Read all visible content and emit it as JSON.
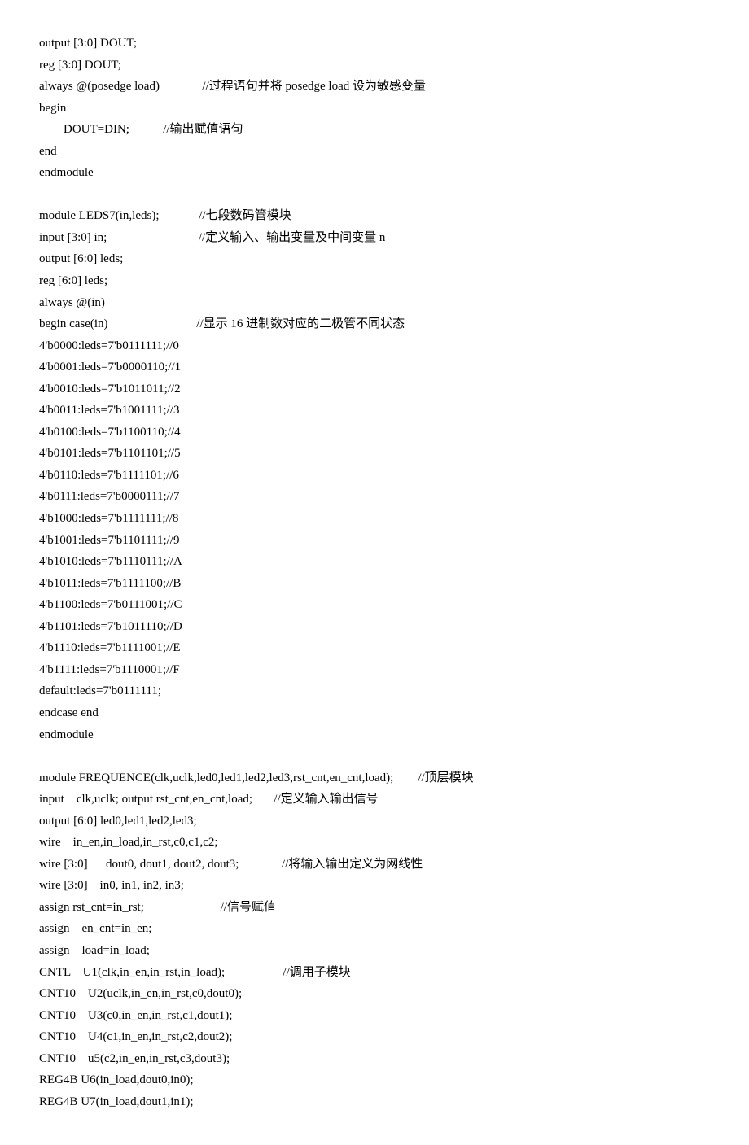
{
  "lines": [
    "output [3:0] DOUT;",
    "reg [3:0] DOUT;",
    "always @(posedge load)              //过程语句并将 posedge load 设为敏感变量",
    "begin",
    "        DOUT=DIN;           //输出赋值语句",
    "end",
    "endmodule",
    "",
    "module LEDS7(in,leds);             //七段数码管模块",
    "input [3:0] in;                              //定义输入、输出变量及中间变量 n",
    "output [6:0] leds;",
    "reg [6:0] leds;",
    "always @(in)",
    "begin case(in)                             //显示 16 进制数对应的二极管不同状态",
    "4'b0000:leds=7'b0111111;//0",
    "4'b0001:leds=7'b0000110;//1",
    "4'b0010:leds=7'b1011011;//2",
    "4'b0011:leds=7'b1001111;//3",
    "4'b0100:leds=7'b1100110;//4",
    "4'b0101:leds=7'b1101101;//5",
    "4'b0110:leds=7'b1111101;//6",
    "4'b0111:leds=7'b0000111;//7",
    "4'b1000:leds=7'b1111111;//8",
    "4'b1001:leds=7'b1101111;//9",
    "4'b1010:leds=7'b1110111;//A",
    "4'b1011:leds=7'b1111100;//B",
    "4'b1100:leds=7'b0111001;//C",
    "4'b1101:leds=7'b1011110;//D",
    "4'b1110:leds=7'b1111001;//E",
    "4'b1111:leds=7'b1110001;//F",
    "default:leds=7'b0111111;",
    "endcase end",
    "endmodule",
    "",
    "module FREQUENCE(clk,uclk,led0,led1,led2,led3,rst_cnt,en_cnt,load);        //顶层模块",
    "input    clk,uclk; output rst_cnt,en_cnt,load;       //定义输入输出信号",
    "output [6:0] led0,led1,led2,led3;",
    "wire    in_en,in_load,in_rst,c0,c1,c2;",
    "wire [3:0]      dout0, dout1, dout2, dout3;              //将输入输出定义为网线性",
    "wire [3:0]    in0, in1, in2, in3;",
    "assign rst_cnt=in_rst;                         //信号赋值",
    "assign    en_cnt=in_en;",
    "assign    load=in_load;",
    "CNTL    U1(clk,in_en,in_rst,in_load);                   //调用子模块",
    "CNT10    U2(uclk,in_en,in_rst,c0,dout0);",
    "CNT10    U3(c0,in_en,in_rst,c1,dout1);",
    "CNT10    U4(c1,in_en,in_rst,c2,dout2);",
    "CNT10    u5(c2,in_en,in_rst,c3,dout3);",
    "REG4B U6(in_load,dout0,in0);",
    "REG4B U7(in_load,dout1,in1);"
  ]
}
